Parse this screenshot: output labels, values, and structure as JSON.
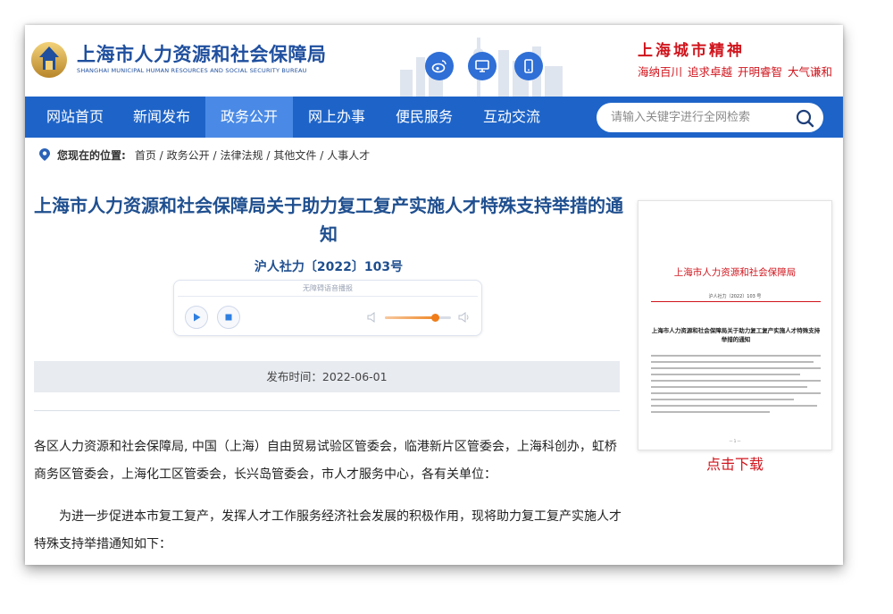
{
  "header": {
    "site_name": "上海市人力资源和社会保障局",
    "site_name_en": "SHANGHAI MUNICIPAL HUMAN RESOURCES AND SOCIAL SECURITY BUREAU",
    "social_icons": [
      "weibo-icon",
      "monitor-icon",
      "mobile-icon"
    ],
    "spirit_title": "上海城市精神",
    "spirit_phrases": [
      "海纳百川",
      "追求卓越",
      "开明睿智",
      "大气谦和"
    ]
  },
  "nav": {
    "items": [
      "网站首页",
      "新闻发布",
      "政务公开",
      "网上办事",
      "便民服务",
      "互动交流"
    ],
    "active": "政务公开",
    "search_placeholder": "请输入关键字进行全网检索"
  },
  "breadcrumb": {
    "label": "您现在的位置:",
    "items": [
      "首页 /",
      "政务公开 /",
      "法律法规 /",
      "其他文件 /",
      "人事人才"
    ]
  },
  "article": {
    "title": "上海市人力资源和社会保障局关于助力复工复产实施人才特殊支持举措的通知",
    "doc_number": "沪人社力〔2022〕103号",
    "player_label": "无障碍语音播报",
    "volume_level": 0.75,
    "publish_time": "发布时间：2022-06-01",
    "paragraphs": [
      "各区人力资源和社会保障局, 中国（上海）自由贸易试验区管委会，临港新片区管委会，上海科创办，虹桥商务区管委会，上海化工区管委会，长兴岛管委会，市人才服务中心，各有关单位：",
      "为进一步促进本市复工复产，发挥人才工作服务经济社会发展的积极作用，现将助力复工复产实施人才特殊支持举措通知如下："
    ]
  },
  "sidebar": {
    "thumb_head": "上海市人力资源和社会保障局",
    "thumb_no": "沪人社力〔2022〕103 号",
    "thumb_title": "上海市人力资源和社会保障局关于助力复工复产实施人才特殊支持举措的通知",
    "download_label": "点击下载"
  },
  "colors": {
    "nav_bg": "#1e64c8",
    "nav_active": "#4a8ae6",
    "title_blue": "#1f4f8f",
    "accent_red": "#d0141c"
  }
}
